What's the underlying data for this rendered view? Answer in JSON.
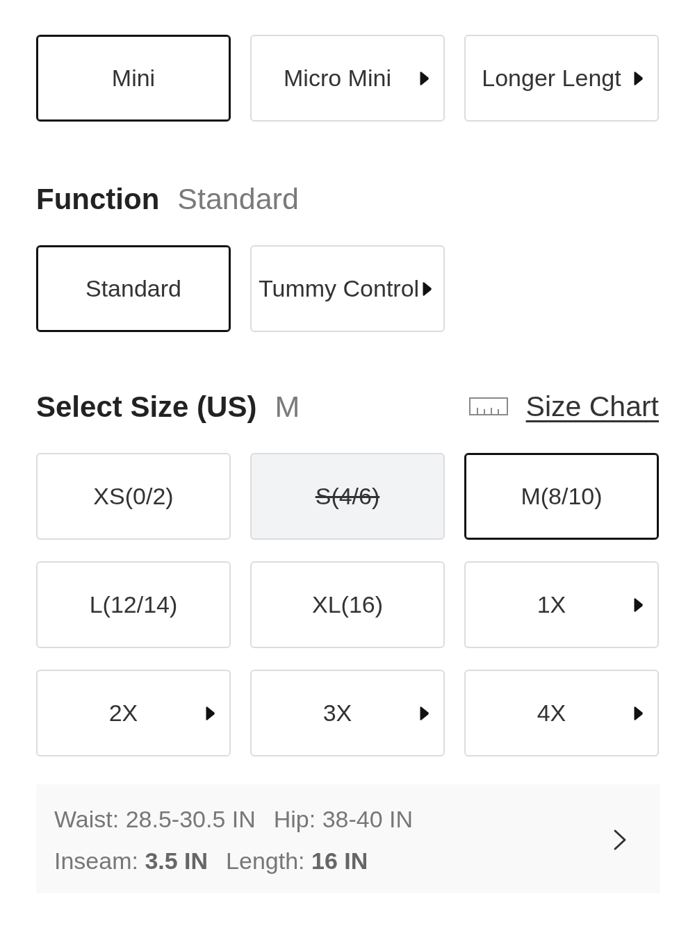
{
  "length_options": [
    {
      "label": "Mini",
      "selected": true,
      "arrow": false
    },
    {
      "label": "Micro Mini",
      "selected": false,
      "arrow": true
    },
    {
      "label": "Longer Lengt",
      "selected": false,
      "arrow": true
    }
  ],
  "function": {
    "title": "Function",
    "value": "Standard",
    "options": [
      {
        "label": "Standard",
        "selected": true,
        "arrow": false
      },
      {
        "label": "Tummy Control",
        "selected": false,
        "arrow": true
      }
    ]
  },
  "size": {
    "title": "Select Size (US)",
    "value": "M",
    "size_chart_link": "Size Chart",
    "options": [
      {
        "label": "XS(0/2)",
        "selected": false,
        "disabled": false,
        "arrow": false
      },
      {
        "label": "S(4/6)",
        "selected": false,
        "disabled": true,
        "arrow": false
      },
      {
        "label": "M(8/10)",
        "selected": true,
        "disabled": false,
        "arrow": false
      },
      {
        "label": "L(12/14)",
        "selected": false,
        "disabled": false,
        "arrow": false
      },
      {
        "label": "XL(16)",
        "selected": false,
        "disabled": false,
        "arrow": false
      },
      {
        "label": "1X",
        "selected": false,
        "disabled": false,
        "arrow": true
      },
      {
        "label": "2X",
        "selected": false,
        "disabled": false,
        "arrow": true
      },
      {
        "label": "3X",
        "selected": false,
        "disabled": false,
        "arrow": true
      },
      {
        "label": "4X",
        "selected": false,
        "disabled": false,
        "arrow": true
      }
    ]
  },
  "measurements": {
    "lines": [
      [
        "Waist: 28.5-30.5 IN",
        "Hip: 38-40 IN"
      ],
      [
        "Inseam: **3.5 IN**",
        "Length: **16 IN**"
      ]
    ]
  }
}
